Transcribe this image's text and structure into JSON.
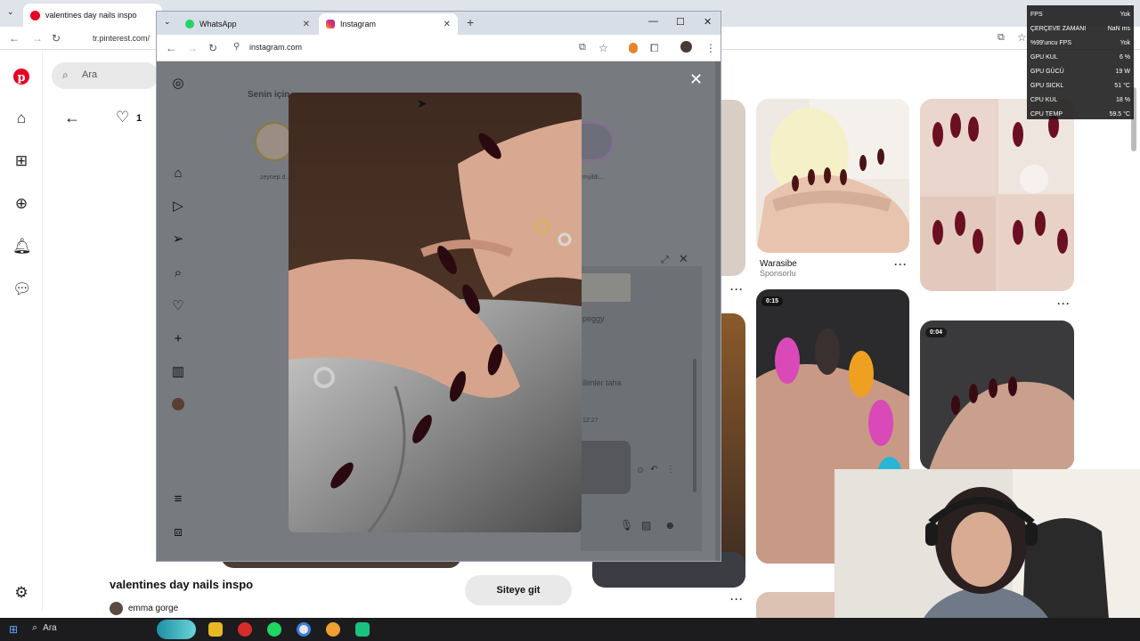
{
  "back_browser": {
    "tab_title": "valentines day nails inspo",
    "url": "tr.pinterest.com/",
    "search_placeholder": "Ara",
    "like_count": "1",
    "pin_title": "valentines day nails inspo",
    "pin_author": "emma gorge",
    "visit_button": "Siteye git",
    "grid": {
      "promoted_title": "Warasibe",
      "promoted_label": "Sponsorlu",
      "video1_time": "0:15",
      "video2_time": "0:04",
      "more": "···"
    }
  },
  "front_browser": {
    "tabs": [
      {
        "label": "WhatsApp",
        "icon": "whatsapp-icon"
      },
      {
        "label": "Instagram",
        "icon": "instagram-icon",
        "active": true
      }
    ],
    "url": "instagram.com",
    "ig": {
      "section_title": "Senin için",
      "story1_name": "zeynep.d...",
      "story2_name": "myildi...",
      "dm_name": "peggy",
      "dm_preview": "ilimler taha",
      "dm_time": "12:27"
    }
  },
  "fps_overlay": [
    {
      "label": "FPS",
      "value": "Yok"
    },
    {
      "label": "ÇERÇEVE ZAMANI",
      "value": "NaN ms"
    },
    {
      "label": "%99'uncu FPS",
      "value": "Yok"
    },
    {
      "label": "GPU KUL",
      "value": "6 %"
    },
    {
      "label": "GPU GÜCÜ",
      "value": "19 W"
    },
    {
      "label": "GPU SICKL",
      "value": "51 °C"
    },
    {
      "label": "CPU KUL",
      "value": "18 %"
    },
    {
      "label": "CPU TEMP",
      "value": "59.5 °C"
    }
  ],
  "taskbar": {
    "search_label": "Ara"
  },
  "colors": {
    "pinterest_red": "#e60023",
    "whatsapp_green": "#25d366",
    "overlay_gray": "#777a7e"
  }
}
